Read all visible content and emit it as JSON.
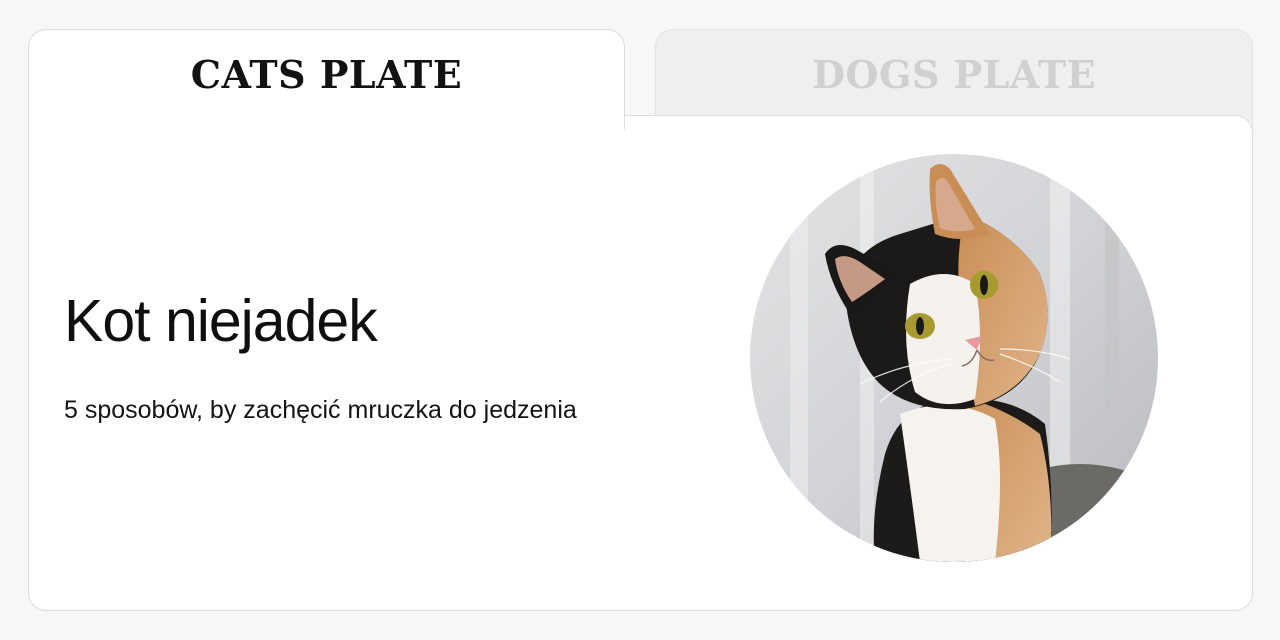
{
  "tabs": [
    {
      "label": "CATS PLATE",
      "active": true
    },
    {
      "label": "DOGS PLATE",
      "active": false
    }
  ],
  "article": {
    "title": "Kot niejadek",
    "subtitle": "5 sposobów, by zachęcić mruczka do jedzenia",
    "image_subject": "calico cat"
  },
  "colors": {
    "active_tab_bg": "#ffffff",
    "inactive_tab_bg": "#efefef",
    "inactive_tab_text": "#d0d0d0",
    "border": "#dcdcdc"
  }
}
